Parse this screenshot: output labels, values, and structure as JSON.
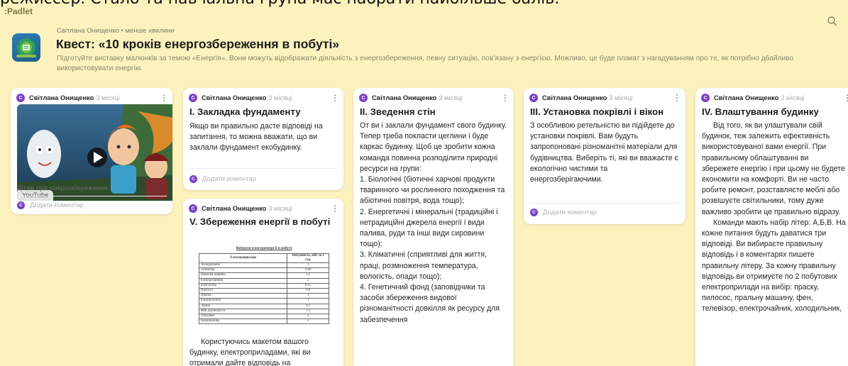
{
  "top_cut_text": "режиссёр. Стало та навчальна група має набрати найбільше балів.",
  "app": {
    "brand": "Padlet"
  },
  "header": {
    "meta": "Світлана Онищенко • менше хвилини",
    "title": "Квест: «10 кроків енергозбереження в побуті»",
    "description": "Підготуйте  виставку малюнків за темою «Енергія». Вони можуть відображати діяльність з енергозбереження, певну ситуацію, пов'язану з енергією. Можливо, це буде плакат з нагадуванням про те, як потрібно дбайливо використовувати енергію."
  },
  "colors": {
    "background": "#fbf2bd",
    "avatar": "#7a3fc8"
  },
  "avatar_letter": "С",
  "card_author": "Світлана Онищенко",
  "card_time": "3 місяці",
  "comment_label": "Додати коментар",
  "cards": {
    "video": {
      "badge": "YouTube",
      "caption": "Дітям про енергозбереження"
    },
    "c1": {
      "title": "І. Закладка фундаменту",
      "body": "Якщо ви правильно дасте відповіді на запитання, то можна вважати, що ви заклали фундамент екобудинку."
    },
    "c2": {
      "title": "ІІ. Зведення стін",
      "body": "От ви і заклали фундамент свого будинку.  Тепер треба покласти цеглини і буде каркас будинку. Щоб це зробити кожна команда повинна  розподілити природні ресурси на групи:\n1. Біологічні (біотичні харчові продукти тваринного чи рослинного походження та абіотичні повітря, вода тощо);\n2. Енергетичні і мінеральні (традиційні і нетрадиційні джерела енергії і види палива, руди та інші види сировини тощо);\n3. Кліматичні (сприятливі для життя, праці, розмноження температура, вологість, опади тощо);\n 4. Генетичний фонд (заповідники та засоби збереження видової різноманітності довкілля як ресурсу для забезпечення"
    },
    "c3": {
      "title": "ІІІ. Установка покрівлі і вікон",
      "body": "З особливою ретельністю ви  підійдете  до установки покрівлі. Вам будуть запропоновані різноманітні матеріали для будівництва. Виберіть ті, які ви вважаєте є екологічно чистими та енергозберігаючими."
    },
    "c4": {
      "title": "ІV. Влаштування будинку",
      "body_p1": "Від того, як ви улаштували свій будинок, теж залежить ефективність використовуваної вами енергії. При правильному облаштуванні ви збережете енергію і при цьому не будете економити  на комфорті. Ви не часто робите ремонт, розставляєте меблі або розвішуєте світильники, тому дуже важливо зробити це правильно відразу.",
      "body_p2": "Команди  мають  набір літер: А,Б,В. На кожне питання будуть даватися три відповіді. Ви вибираєте правильну відповідь і в коментарях пишете правильну літеру.  За кожну правильну відповідь ви отримуєте по 2 побутових електроприлади на вибір:  праску, пилосос, пральну машину, фен, телевізор, електрочайник, холодильник,"
    },
    "c5": {
      "title": "V. Збереження енергії в побуті",
      "body": "Користуючись макетом вашого будинку, електроприладами, які ви отримали дайте відповідь на",
      "table": {
        "title": "Витрати електроенергії в побуті",
        "col1": "Електроприлади",
        "col2": "Потужність, кВт за 1 год.",
        "rows": [
          [
            "Холодильник",
            "1"
          ],
          [
            "Телевізор",
            "0.08"
          ],
          [
            "Пральна машина",
            "1.5"
          ],
          [
            "Електрочайник",
            "2"
          ],
          [
            "Комп'ютер",
            "0.15"
          ],
          [
            "Пилосос",
            "0.8"
          ],
          [
            "Праска",
            "1"
          ],
          [
            "Електроплита",
            "1"
          ],
          [
            "Лампа",
            "0.1"
          ],
          [
            "Фен для волосся",
            "1.5"
          ],
          [
            "Обігрівач",
            "2"
          ],
          [
            "Кондиціонер",
            "2"
          ]
        ]
      }
    }
  }
}
